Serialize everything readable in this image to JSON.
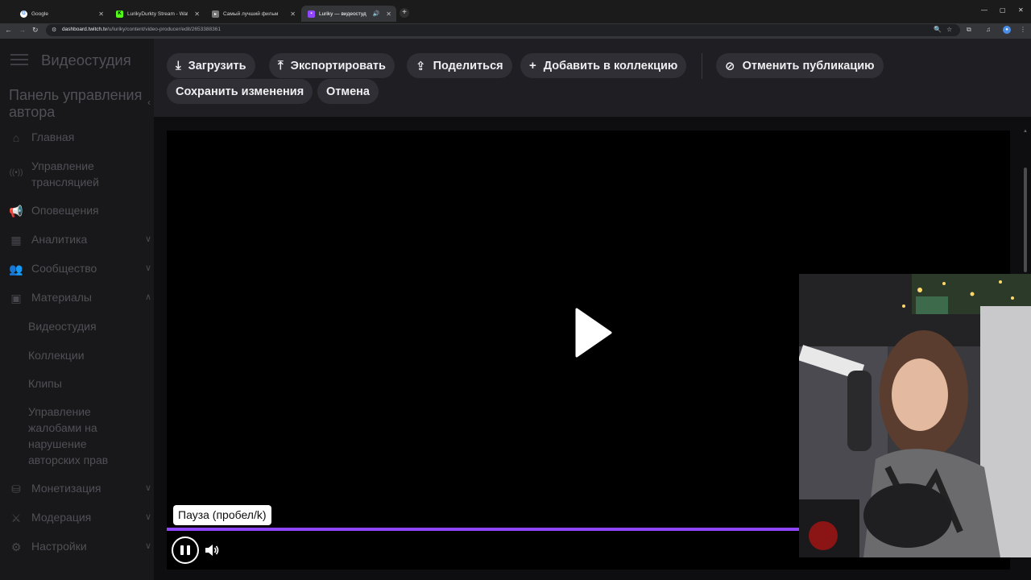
{
  "browser": {
    "tabs": [
      {
        "title": "Google",
        "active": false
      },
      {
        "title": "LurikyDurkty Stream - Watch Li",
        "active": false
      },
      {
        "title": "Самый лучший фильм",
        "active": false
      },
      {
        "title": "Luriky — видеостудия - Tw",
        "active": true
      }
    ],
    "url_host": "dashboard.twitch.tv",
    "url_path": "/u/luriky/content/video-producer/edit/2653388361"
  },
  "sidebar": {
    "studio_title": "Видеостудия",
    "panel_title": "Панель управления автора",
    "items": [
      {
        "label": "Главная",
        "icon": "home-icon"
      },
      {
        "label": "Управление трансляцией",
        "icon": "broadcast-icon"
      },
      {
        "label": "Оповещения",
        "icon": "megaphone-icon"
      },
      {
        "label": "Аналитика",
        "icon": "analytics-icon"
      },
      {
        "label": "Сообщество",
        "icon": "community-icon"
      },
      {
        "label": "Материалы",
        "icon": "content-icon"
      },
      {
        "label": "Монетизация",
        "icon": "money-icon"
      },
      {
        "label": "Модерация",
        "icon": "moderation-icon"
      },
      {
        "label": "Настройки",
        "icon": "settings-icon"
      }
    ],
    "sub_items": [
      {
        "label": "Видеостудия"
      },
      {
        "label": "Коллекции"
      },
      {
        "label": "Клипы"
      },
      {
        "label": "Управление жалобами на нарушение авторских прав"
      }
    ]
  },
  "toolbar": {
    "upload": "Загрузить",
    "export": "Экспортировать",
    "share": "Поделиться",
    "add_to_collection": "Добавить в коллекцию",
    "unpublish": "Отменить публикацию",
    "save": "Сохранить изменения",
    "cancel": "Отмена"
  },
  "player": {
    "tooltip": "Пауза (пробел/k)",
    "progress": 0.78
  },
  "colors": {
    "accent": "#9147ff",
    "button_bg": "#2f2f35",
    "toolbar_bg": "#1f1f23"
  }
}
